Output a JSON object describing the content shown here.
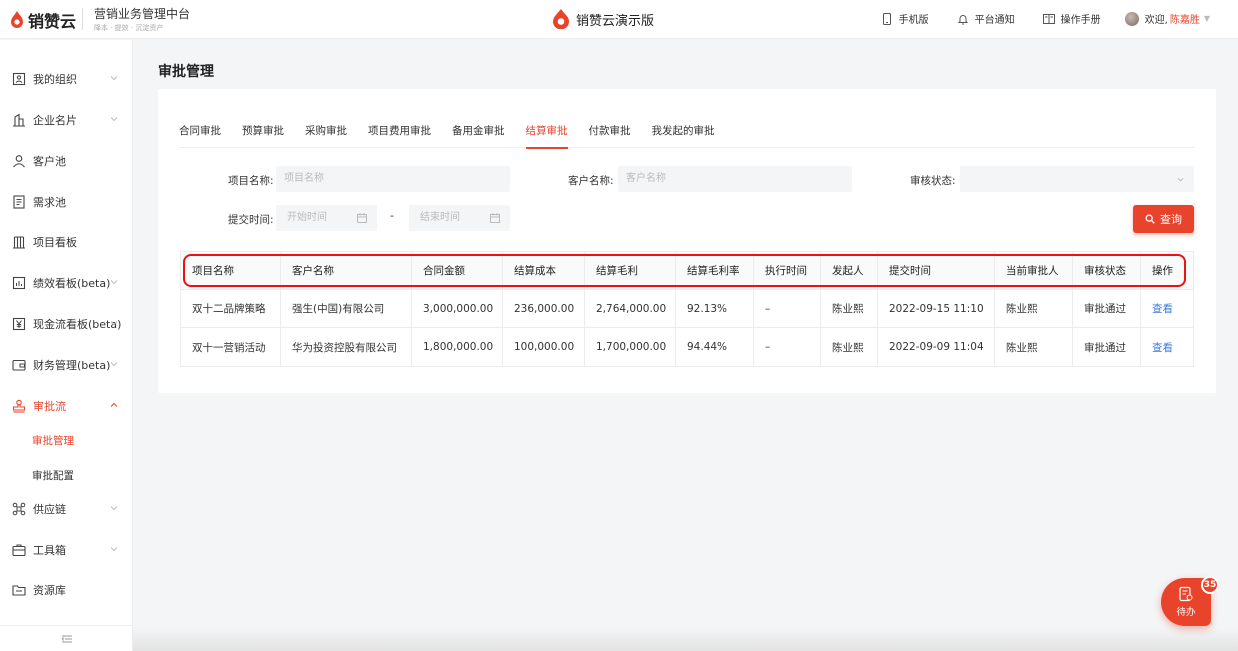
{
  "header": {
    "logo_text": "销赞云",
    "platform_title": "营销业务管理中台",
    "platform_subtitle": "降本 · 提效 · 沉淀资产",
    "center_brand": "销赞云演示版",
    "actions": [
      {
        "label": "手机版",
        "icon": "mobile-icon"
      },
      {
        "label": "平台通知",
        "icon": "bell-icon"
      },
      {
        "label": "操作手册",
        "icon": "book-icon"
      }
    ],
    "welcome": "欢迎,",
    "user_name": "陈嘉胜"
  },
  "sidebar": {
    "items": [
      {
        "label": "我的组织",
        "icon": "org-icon"
      },
      {
        "label": "企业名片",
        "icon": "building-icon"
      },
      {
        "label": "客户池",
        "icon": "user-icon"
      },
      {
        "label": "需求池",
        "icon": "doc-icon"
      },
      {
        "label": "项目看板",
        "icon": "board-icon"
      },
      {
        "label": "绩效看板(beta)",
        "icon": "chart-icon"
      },
      {
        "label": "现金流看板(beta)",
        "icon": "yen-icon"
      },
      {
        "label": "财务管理(beta)",
        "icon": "wallet-icon"
      },
      {
        "label": "审批流",
        "icon": "stamp-icon"
      },
      {
        "label": "供应链",
        "icon": "chain-icon"
      },
      {
        "label": "工具箱",
        "icon": "toolbox-icon"
      },
      {
        "label": "资源库",
        "icon": "folder-icon"
      }
    ],
    "sub_items": [
      "审批管理",
      "审批配置"
    ]
  },
  "page": {
    "title": "审批管理",
    "tabs": [
      "合同审批",
      "预算审批",
      "采购审批",
      "项目费用审批",
      "备用金审批",
      "结算审批",
      "付款审批",
      "我发起的审批"
    ],
    "active_tab": "结算审批"
  },
  "filters": {
    "project_label": "项目名称:",
    "project_placeholder": "项目名称",
    "customer_label": "客户名称:",
    "customer_placeholder": "客户名称",
    "status_label": "审核状态:",
    "status_value": "",
    "time_label": "提交时间:",
    "start_placeholder": "开始时间",
    "end_placeholder": "结束时间",
    "dash": "-",
    "query_label": "查询"
  },
  "table": {
    "columns": [
      "项目名称",
      "客户名称",
      "合同金额",
      "结算成本",
      "结算毛利",
      "结算毛利率",
      "执行时间",
      "发起人",
      "提交时间",
      "当前审批人",
      "审核状态",
      "操作"
    ],
    "rows": [
      [
        "双十二品牌策略",
        "强生(中国)有限公司",
        "3,000,000.00",
        "236,000.00",
        "2,764,000.00",
        "92.13%",
        "–",
        "陈业熙",
        "2022-09-15 11:10",
        "陈业熙",
        "审批通过",
        "查看"
      ],
      [
        "双十一营销活动",
        "华为投资控股有限公司",
        "1,800,000.00",
        "100,000.00",
        "1,700,000.00",
        "94.44%",
        "–",
        "陈业熙",
        "2022-09-09 11:04",
        "陈业熙",
        "审批通过",
        "查看"
      ]
    ]
  },
  "todo": {
    "label": "待办",
    "count": "35"
  },
  "colors": {
    "accent": "#e8442c",
    "link": "#3a7ddb"
  }
}
